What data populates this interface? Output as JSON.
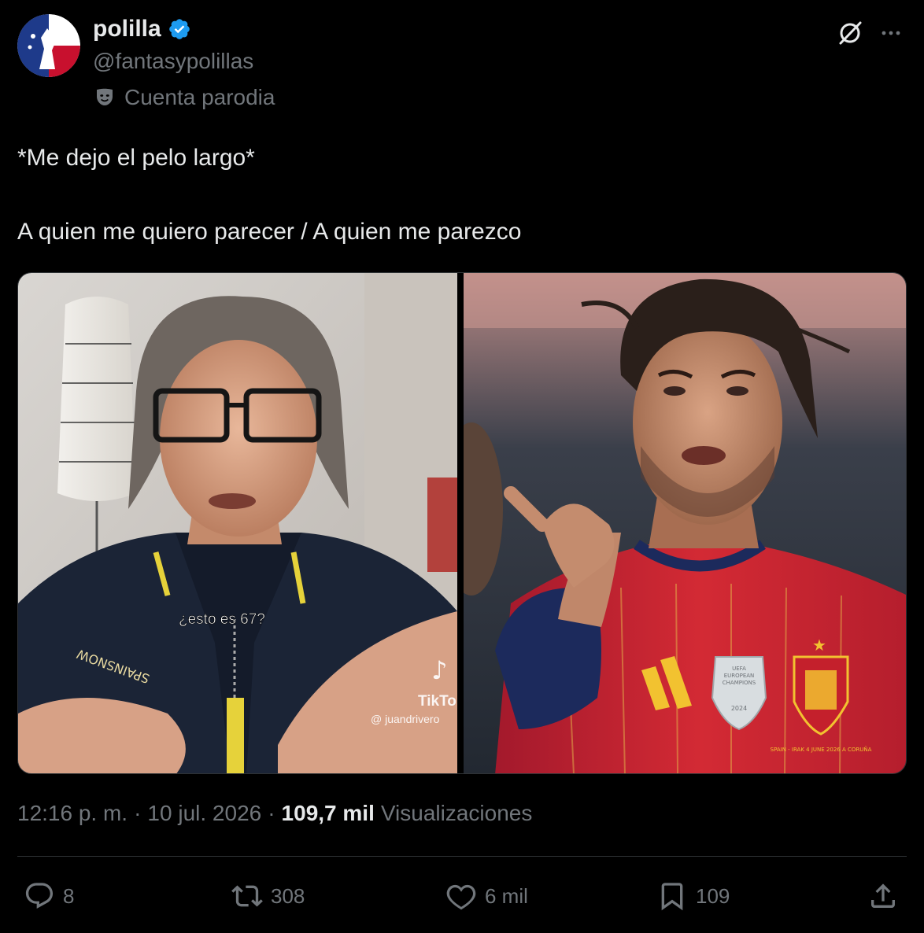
{
  "author": {
    "name": "polilla",
    "handle": "@fantasypolillas",
    "parody_label": "Cuenta parodia",
    "verified_color": "#1d9bf0"
  },
  "tweet": {
    "line1": "*Me dejo el pelo largo*",
    "line2": "A quien me quiero parecer / A quien me parezco"
  },
  "media": {
    "left_caption": "¿esto es 67?",
    "left_watermark_brand": "TikTok",
    "left_watermark_user": "@ juandrivero",
    "right_badge_line1": "UEFA",
    "right_badge_line2": "EUROPEAN",
    "right_badge_line3": "CHAMPIONS",
    "right_badge_year": "2024",
    "right_match_info": "SPAIN - IRAK 4 JUNE 2026 A CORUÑA"
  },
  "meta": {
    "time": "12:16 p. m.",
    "dot1": "·",
    "date": "10 jul. 2026",
    "dot2": "·",
    "views_count": "109,7 mil",
    "views_label": "Visualizaciones"
  },
  "actions": {
    "replies": "8",
    "reposts": "308",
    "likes": "6 mil",
    "bookmarks": "109"
  },
  "colors": {
    "background": "#000000",
    "text": "#e7e9ea",
    "muted": "#71767b",
    "border": "#2f3336",
    "accent": "#1d9bf0"
  }
}
